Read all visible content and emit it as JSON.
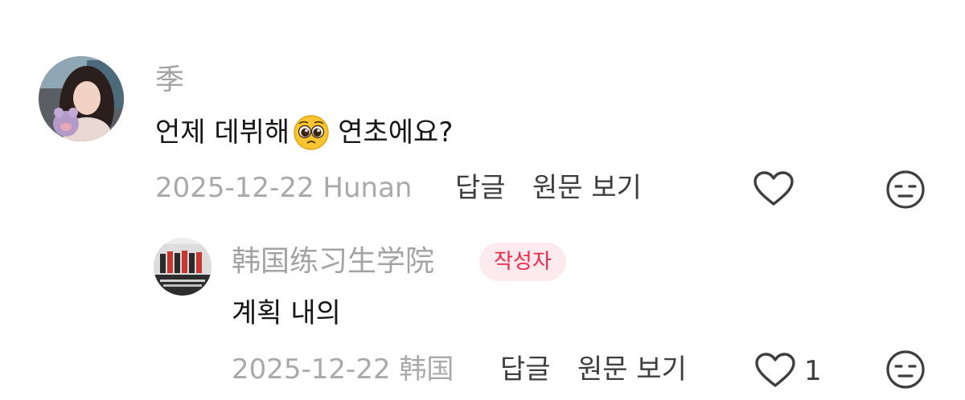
{
  "comments": [
    {
      "username": "季",
      "text_before": "언제 데뷔해",
      "emoji": "pleading-face",
      "text_after": "연초에요?",
      "date_location": "2025-12-22 Hunan",
      "reply_label": "답글",
      "original_label": "원문 보기",
      "like_icon": "heart-outline-icon",
      "like_count": "",
      "react_icon": "neutral-face-icon"
    },
    {
      "username": "韩国练习生学院",
      "badge": "작성자",
      "text": "계획 내의",
      "date_location": "2025-12-22 韩国",
      "reply_label": "답글",
      "original_label": "원문 보기",
      "like_icon": "heart-outline-icon",
      "like_count": "1",
      "react_icon": "neutral-face-icon"
    }
  ],
  "colors": {
    "username": "#a3a3a3",
    "meta": "#a9a9a9",
    "badge_bg": "#fdeaee",
    "badge_text": "#f4294a",
    "icon": "#3e3e3e"
  }
}
